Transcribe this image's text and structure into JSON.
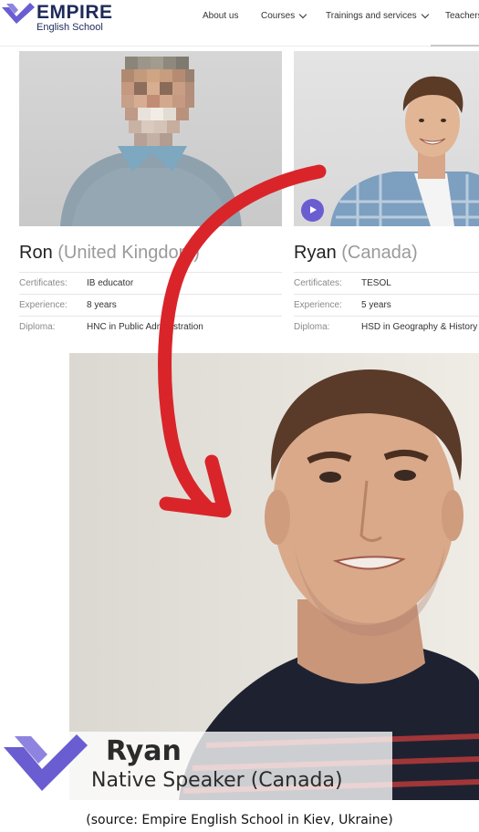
{
  "header": {
    "logo_name": "EMPIRE",
    "logo_sub": "English School",
    "nav": [
      {
        "label": "About us",
        "has_dropdown": false
      },
      {
        "label": "Courses",
        "has_dropdown": true
      },
      {
        "label": "Trainings and services",
        "has_dropdown": true
      },
      {
        "label": "Teachers",
        "has_dropdown": false
      }
    ]
  },
  "teachers": [
    {
      "name": "Ron",
      "country": "(United Kingdom)",
      "has_video": false,
      "photo_pixelated": true,
      "details": [
        {
          "label": "Certificates:",
          "value": "IB educator"
        },
        {
          "label": "Experience:",
          "value": "8 years"
        },
        {
          "label": "Diploma:",
          "value": "HNC in Public Administration"
        }
      ]
    },
    {
      "name": "Ryan",
      "country": "(Canada)",
      "has_video": true,
      "photo_pixelated": false,
      "details": [
        {
          "label": "Certificates:",
          "value": "TESOL"
        },
        {
          "label": "Experience:",
          "value": "5 years"
        },
        {
          "label": "Diploma:",
          "value": "HSD in Geography & History"
        }
      ]
    }
  ],
  "video_caption": {
    "name": "Ryan",
    "role": "Native Speaker (Canada)"
  },
  "source_note": "(source: Empire English School in Kiev, Ukraine)",
  "colors": {
    "brand_navy": "#1e2a5a",
    "brand_purple": "#6a5dd1",
    "annotation_arrow": "#d9252a",
    "country_gray": "#9a9a9a"
  },
  "icons": [
    "empire-logo-icon",
    "chevron-down-icon",
    "play-icon",
    "red-arrow-annotation"
  ]
}
